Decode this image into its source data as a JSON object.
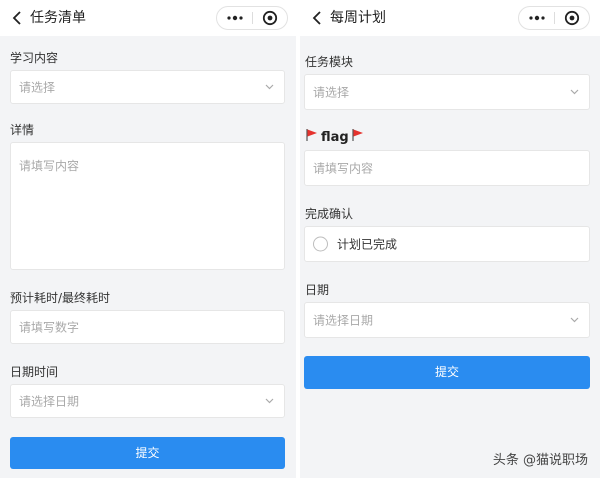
{
  "left": {
    "title": "任务清单",
    "fields": {
      "study_label": "学习内容",
      "study_placeholder": "请选择",
      "detail_label": "详情",
      "detail_placeholder": "请填写内容",
      "time_label": "预计耗时/最终耗时",
      "time_placeholder": "请填写数字",
      "date_label": "日期时间",
      "date_placeholder": "请选择日期"
    },
    "submit_label": "提交"
  },
  "right": {
    "title": "每周计划",
    "fields": {
      "module_label": "任务模块",
      "module_placeholder": "请选择",
      "flag_text": "flag",
      "flag_placeholder": "请填写内容",
      "confirm_label": "完成确认",
      "confirm_option": "计划已完成",
      "date_label": "日期",
      "date_placeholder": "请选择日期"
    },
    "submit_label": "提交"
  },
  "watermark": "头条 @猫说职场",
  "icons": {
    "back": "chevron-left-icon",
    "more": "more-dots-icon",
    "close": "target-circle-icon",
    "dropdown": "chevron-down-icon",
    "flag": "red-flag-icon"
  },
  "colors": {
    "primary": "#2a8cf0",
    "flag": "#e5322d",
    "page_bg": "#f3f4f6"
  }
}
